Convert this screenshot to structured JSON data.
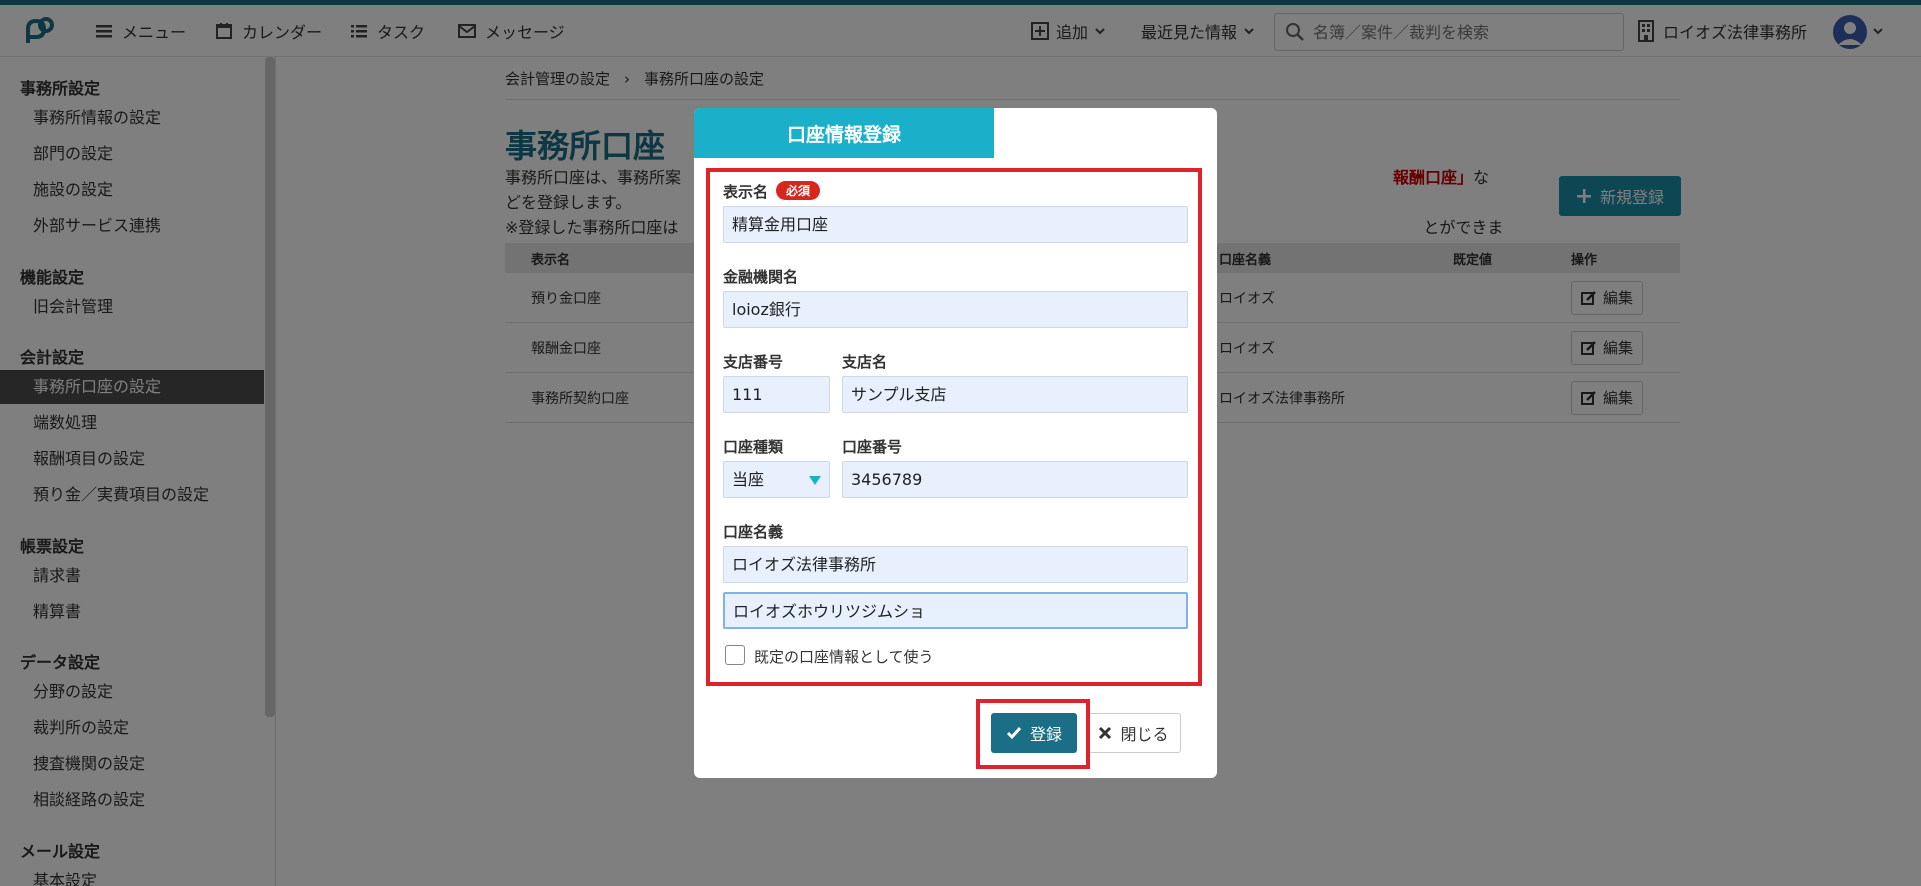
{
  "header": {
    "menu_label": "メニュー",
    "calendar_label": "カレンダー",
    "task_label": "タスク",
    "message_label": "メッセージ",
    "add_label": "追加",
    "recent_label": "最近見た情報",
    "search_placeholder": "名簿／案件／裁判を検索",
    "office_name": "ロイオズ法律事務所"
  },
  "sidebar": {
    "sections": [
      {
        "title": "事務所設定",
        "items": [
          "事務所情報の設定",
          "部門の設定",
          "施設の設定",
          "外部サービス連携"
        ]
      },
      {
        "title": "機能設定",
        "items": [
          "旧会計管理"
        ]
      },
      {
        "title": "会計設定",
        "items": [
          "事務所口座の設定",
          "端数処理",
          "報酬項目の設定",
          "預り金／実費項目の設定"
        ]
      },
      {
        "title": "帳票設定",
        "items": [
          "請求書",
          "精算書"
        ]
      },
      {
        "title": "データ設定",
        "items": [
          "分野の設定",
          "裁判所の設定",
          "捜査機関の設定",
          "相談経路の設定"
        ]
      },
      {
        "title": "メール設定",
        "items": [
          "基本設定"
        ]
      }
    ]
  },
  "main": {
    "breadcrumb": [
      "会計管理の設定",
      "事務所口座の設定"
    ],
    "breadcrumb_sep": "›",
    "title": "事務所口座",
    "desc_line1_a": "事務所口座は、事務所案",
    "desc_line1_red": "報酬口座」",
    "desc_line1_b": "などを登録します。",
    "desc_line2_a": "※登録した事務所口座は",
    "desc_line2_b": "とができます。",
    "new_button": "新規登録",
    "table": {
      "headers": [
        "表示名",
        "口座名義",
        "既定値",
        "操作"
      ],
      "rows": [
        {
          "name": "預り金口座",
          "holder": "ロイオズ",
          "edit": "編集"
        },
        {
          "name": "報酬金口座",
          "holder": "ロイオズ",
          "edit": "編集"
        },
        {
          "name": "事務所契約口座",
          "holder": "ロイオズ法律事務所",
          "edit": "編集"
        }
      ]
    }
  },
  "modal": {
    "title": "口座情報登録",
    "display_name_label": "表示名",
    "required_badge": "必須",
    "display_name_value": "精算金用口座",
    "bank_label": "金融機関名",
    "bank_value": "loioz銀行",
    "branch_no_label": "支店番号",
    "branch_no_value": "111",
    "branch_name_label": "支店名",
    "branch_name_value": "サンプル支店",
    "account_type_label": "口座種類",
    "account_type_value": "当座",
    "account_no_label": "口座番号",
    "account_no_value": "3456789",
    "holder_label": "口座名義",
    "holder_value": "ロイオズ法律事務所",
    "holder_kana_value": "ロイオズホウリツジムショ",
    "default_checkbox_label": "既定の口座情報として使う",
    "default_checked": false,
    "submit_label": "登録",
    "close_label": "閉じる"
  }
}
